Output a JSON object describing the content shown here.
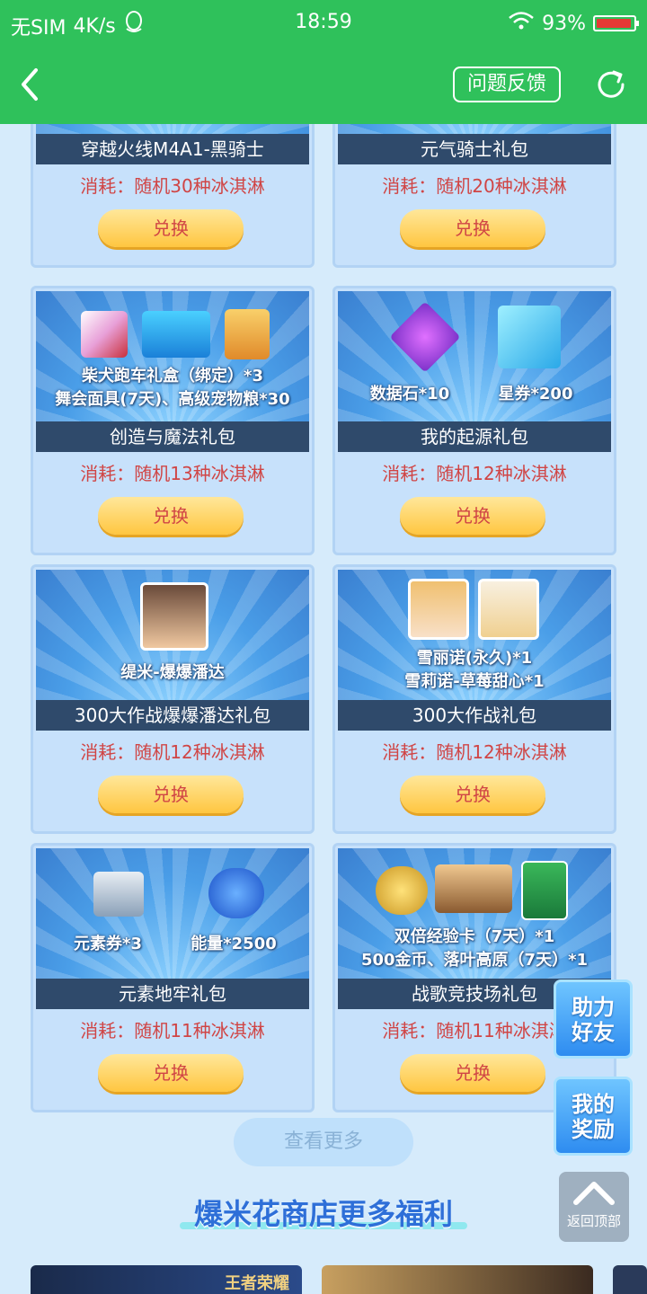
{
  "status_bar": {
    "carrier": "无SIM",
    "speed": "4K/s",
    "time": "18:59",
    "battery": "93%",
    "battery_level": 0.93
  },
  "nav": {
    "feedback_label": "问题反馈"
  },
  "cards": [
    {
      "name": "穿越火线M4A1-黑骑士",
      "cost": "消耗：随机30种冰淇淋",
      "button": "兑换",
      "art_lines": []
    },
    {
      "name": "元气骑士礼包",
      "cost": "消耗：随机20种冰淇淋",
      "button": "兑换",
      "art_lines": []
    },
    {
      "name": "创造与魔法礼包",
      "cost": "消耗：随机13种冰淇淋",
      "button": "兑换",
      "art_lines": [
        "柴犬跑车礼盒（绑定）*3",
        "舞会面具(7天)、高级宠物粮*30"
      ]
    },
    {
      "name": "我的起源礼包",
      "cost": "消耗：随机12种冰淇淋",
      "button": "兑换",
      "art_lines": [
        "数据石*10",
        "星券*200"
      ]
    },
    {
      "name": "300大作战爆爆潘达礼包",
      "cost": "消耗：随机12种冰淇淋",
      "button": "兑换",
      "art_lines": [
        "缇米-爆爆潘达"
      ]
    },
    {
      "name": "300大作战礼包",
      "cost": "消耗：随机12种冰淇淋",
      "button": "兑换",
      "art_lines": [
        "雪丽诺(永久)*1",
        "雪莉诺-草莓甜心*1"
      ]
    },
    {
      "name": "元素地牢礼包",
      "cost": "消耗：随机11种冰淇淋",
      "button": "兑换",
      "art_lines": [
        "元素券*3",
        "能量*2500"
      ]
    },
    {
      "name": "战歌竞技场礼包",
      "cost": "消耗：随机11种冰淇淋",
      "button": "兑换",
      "art_lines": [
        "双倍经验卡（7天）*1",
        "500金币、落叶高原（7天）*1"
      ]
    }
  ],
  "more_label": "查看更多",
  "section_title": "爆米花商店更多福利",
  "float": {
    "help_friend": [
      "助力",
      "好友"
    ],
    "my_reward": [
      "我的",
      "奖励"
    ],
    "back_top": "返回顶部"
  },
  "promo": {
    "game1": "王者荣耀"
  },
  "colors": {
    "header_green": "#2fc15b",
    "cost_red": "#d04545",
    "accent_blue": "#2e6fd8"
  }
}
